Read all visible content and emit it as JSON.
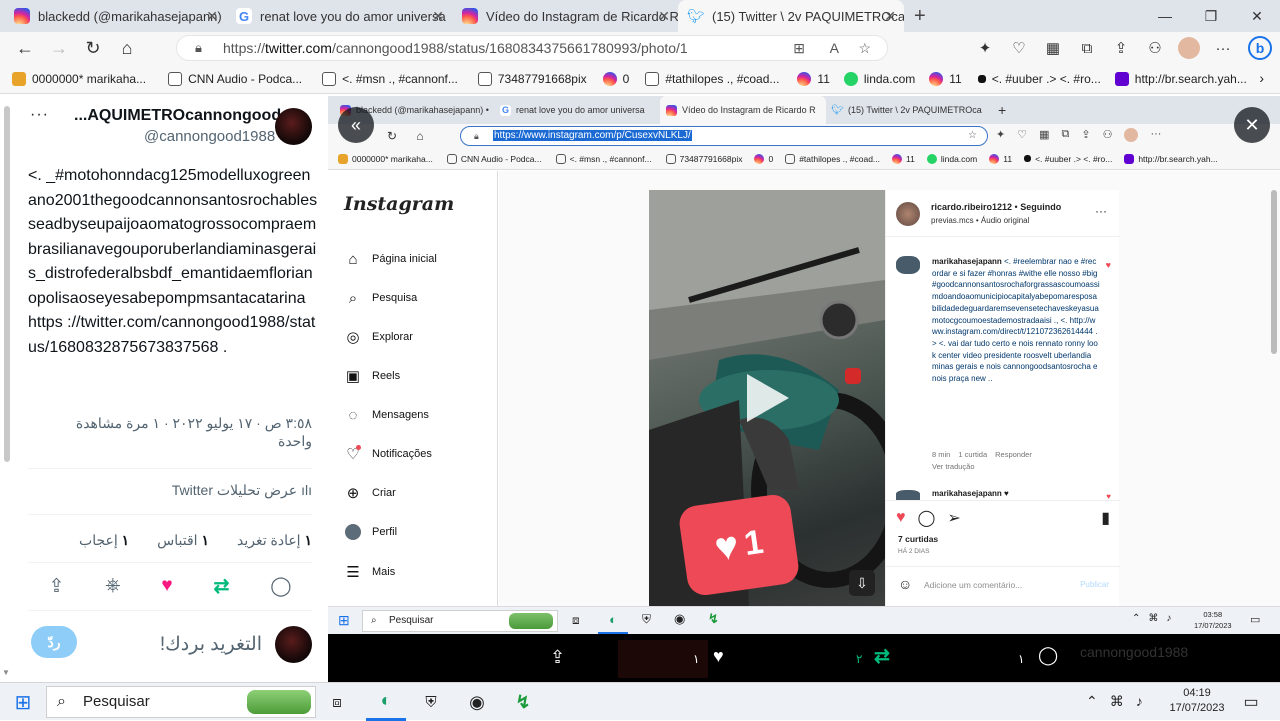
{
  "outer_tabs": [
    {
      "label": "blackedd (@marikahasejapann) •",
      "icon": "instagram-icon"
    },
    {
      "label": "renat love you do amor universa",
      "icon": "google-icon"
    },
    {
      "label": "Vídeo do Instagram de Ricardo R",
      "icon": "instagram-icon"
    },
    {
      "label": "(15) Twitter \\ 2v PAQUIMETROcan",
      "icon": "twitter-icon"
    }
  ],
  "new_tab": "+",
  "address": {
    "prefix": "https://",
    "domain": "twitter.com",
    "path": "/cannongood1988/status/1680834375661780993/photo/1"
  },
  "favorites": [
    {
      "label": "0000000* marikaha...",
      "color": "#e8a42a"
    },
    {
      "label": "CNN Audio - Podca...",
      "color": "#ffffff"
    },
    {
      "label": "<. #msn ., #cannonf...",
      "color": "#ffffff"
    },
    {
      "label": "73487791668pix",
      "color": "#ffffff"
    },
    {
      "label": "0",
      "color": "#d6249f"
    },
    {
      "label": "#tathilopes ., #coad...",
      "color": "#ffffff"
    },
    {
      "label": "11",
      "color": "#d6249f"
    },
    {
      "label": "linda.com",
      "color": "#25d366"
    },
    {
      "label": "11",
      "color": "#d6249f"
    },
    {
      "label": "<. #uuber .> <. #ro...",
      "color": "#111111"
    },
    {
      "label": "http://br.search.yah...",
      "color": "#6001d2"
    }
  ],
  "tweet": {
    "more": "···",
    "display_name": "...AQUIMETROcannongood",
    "handle": "@cannongood1988",
    "text": "<. _#motohonndacg125modelluxogreenano2001thegoodcannonsantosrochablesseadbyseupaijoaomatogrossocompraembrasilianavegouporuberlandiaminasgerais_distrofederalbsbdf_emantidaemflorianopolisaoseyesabepompmsantacatarina https ://twitter.com/cannongood1988/status/1680832875673837568 .",
    "meta_line1": "٣:٥٨ ص · ١٧ يوليو ٢٠٢٢ · ١ مرة مشاهدة",
    "meta_line2": "واحدة",
    "analytics": "عرض تحليلات Twitter",
    "stats": [
      {
        "n": "١",
        "label": "إعادة تغريد"
      },
      {
        "n": "١",
        "label": "اقتباس"
      },
      {
        "n": "١",
        "label": "إعجاب"
      }
    ],
    "reply_placeholder": "التغريد بردك!",
    "reply_button": "ردّ"
  },
  "inner": {
    "tabs": [
      {
        "label": "blackedd (@marikahasejapann) •"
      },
      {
        "label": "renat love you do amor universa"
      },
      {
        "label": "Vídeo do Instagram de Ricardo R"
      },
      {
        "label": "(15) Twitter \\ 2v PAQUIMETROca"
      }
    ],
    "url": "https://www.instagram.com/p/CusexvNLKLJ/",
    "favorites": [
      "0000000* marikaha...",
      "CNN Audio - Podca...",
      "<. #msn ., #cannonf...",
      "73487791668pix",
      "0",
      "#tathilopes ., #coad...",
      "11",
      "linda.com",
      "11",
      "<. #uuber .> <. #ro...",
      "http://br.search.yah..."
    ],
    "instagram": {
      "logo": "Instagram",
      "nav": [
        {
          "label": "Página inicial",
          "icon": "home-icon",
          "glyph": "⌂"
        },
        {
          "label": "Pesquisa",
          "icon": "search-icon",
          "glyph": "⌕"
        },
        {
          "label": "Explorar",
          "icon": "compass-icon",
          "glyph": "◎"
        },
        {
          "label": "Reels",
          "icon": "reels-icon",
          "glyph": "▣"
        },
        {
          "label": "Mensagens",
          "icon": "messenger-icon",
          "glyph": "◌"
        },
        {
          "label": "Notificações",
          "icon": "heart-icon",
          "glyph": "♡"
        },
        {
          "label": "Criar",
          "icon": "plus-icon",
          "glyph": "⊕"
        },
        {
          "label": "Perfil",
          "icon": "avatar",
          "glyph": ""
        },
        {
          "label": "Mais",
          "icon": "menu-icon",
          "glyph": "☰"
        }
      ],
      "post_author": "ricardo.ribeiro1212",
      "follow_state": "Seguindo",
      "audio": "previas.mcs • Áudio original",
      "comment1_user": "marikahasejapann",
      "comment1_text": "<. #reelembrar nao e #recordar e si fazer #honras #withe elle nosso #big #goodcannonsantosrochaforgrassascoumoassimdoandoaomunicipiocapitalyabepomaresposabilidadedeguardaremsevensetechaveskeyasuamotocgcoumoestademostradaaisi ., <. http://www.instagram.com/direct/t/121072362614444 .> <. vai dar tudo certo e nois rennato ronny look center video presidente roosvelt uberlandia minas gerais e nois cannongoodsantosrocha e nois praça new ..",
      "comment1_time": "8 min",
      "comment1_likes": "1 curtida",
      "comment1_reply": "Responder",
      "comment1_translate": "Ver tradução",
      "comment2_user": "marikahasejapann ♥",
      "like_count": "7 curtidas",
      "posted": "HÁ 2 DIAS",
      "add_comment": "Adicione um comentário...",
      "publish": "Publicar",
      "like_badge": "1"
    },
    "taskbar": {
      "search": "Pesquisar",
      "time": "03:58",
      "date": "17/07/2023"
    },
    "darkbar": {
      "likes": "١",
      "retweets": "٢",
      "replies": "١",
      "faded_name": "cannongood1988"
    }
  },
  "taskbar": {
    "search": "Pesquisar",
    "time": "04:19",
    "date": "17/07/2023"
  },
  "colors": {
    "twitter_like": "#f91880",
    "twitter_retweet": "#00ba7c",
    "twitter_blue": "#1d9bf0",
    "ig_red": "#ed4956",
    "ig_link": "#00376b"
  }
}
